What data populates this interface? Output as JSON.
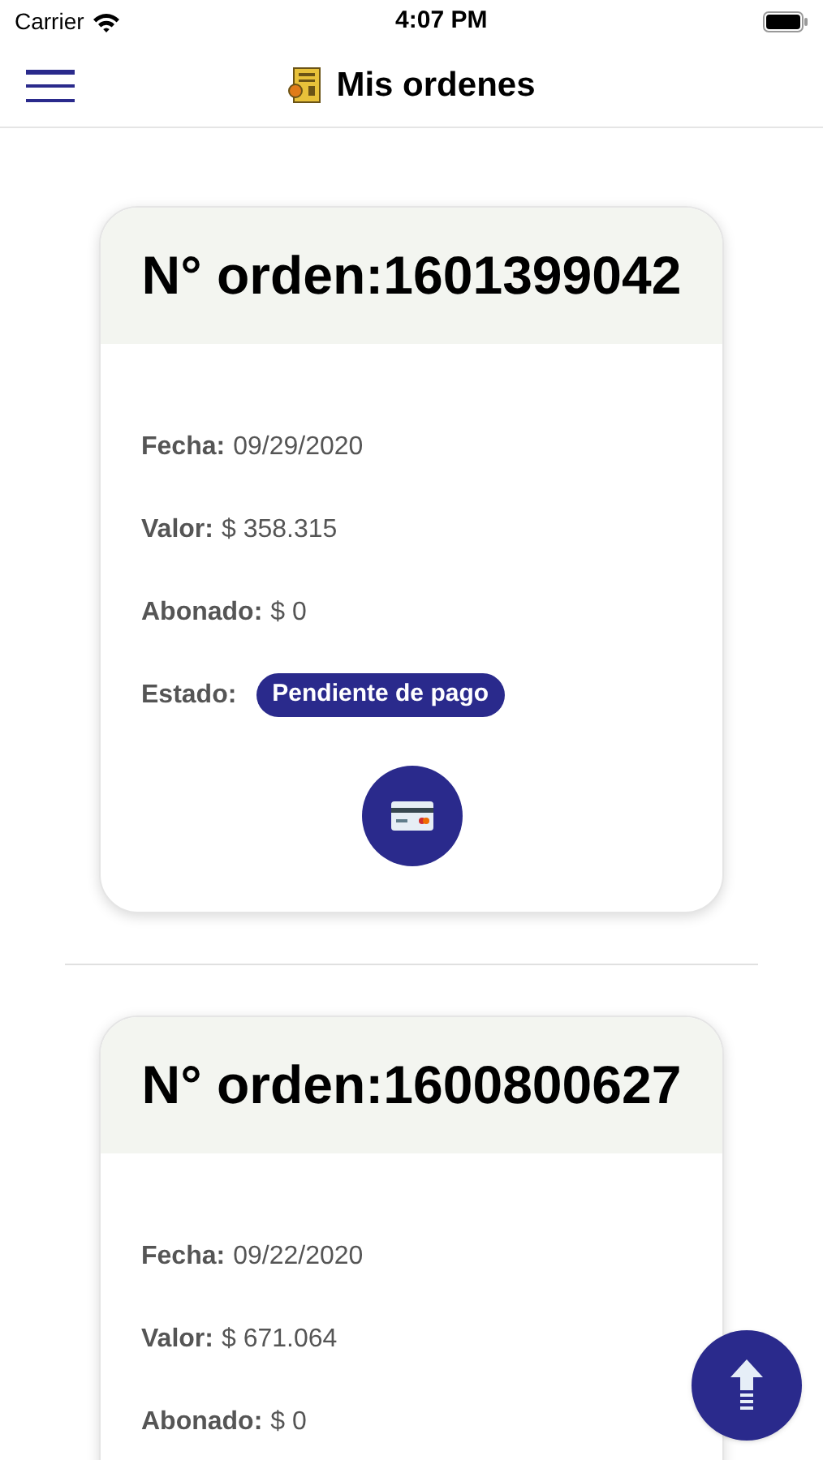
{
  "status_bar": {
    "carrier": "Carrier",
    "time": "4:07 PM"
  },
  "nav": {
    "title": "Mis ordenes"
  },
  "orders": [
    {
      "title": "N° orden:1601399042",
      "fields": [
        {
          "kind": "text",
          "label": "Fecha:",
          "value": "09/29/2020"
        },
        {
          "kind": "text",
          "label": "Valor:",
          "value": "$ 358.315"
        },
        {
          "kind": "text",
          "label": "Abonado:",
          "value": "$ 0"
        },
        {
          "kind": "badge",
          "label": "Estado:",
          "value": "Pendiente de pago"
        },
        {
          "kind": "pay_button"
        }
      ]
    },
    {
      "title": "N° orden:1600800627",
      "fields": [
        {
          "kind": "text",
          "label": "Fecha:",
          "value": "09/22/2020"
        },
        {
          "kind": "text",
          "label": "Valor:",
          "value": "$ 671.064"
        },
        {
          "kind": "text",
          "label": "Abonado:",
          "value": "$ 0"
        }
      ]
    }
  ]
}
